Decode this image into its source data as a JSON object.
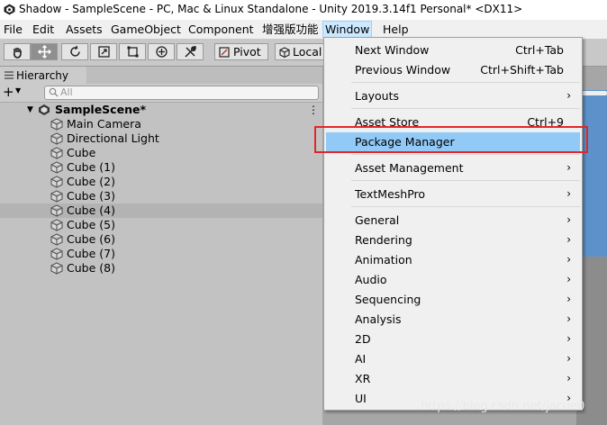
{
  "window": {
    "title": "Shadow - SampleScene - PC, Mac & Linux Standalone - Unity 2019.3.14f1 Personal* <DX11>"
  },
  "menubar": {
    "items": [
      "File",
      "Edit",
      "Assets",
      "GameObject",
      "Component",
      "增强版功能",
      "Window",
      "Help"
    ],
    "active": "Window"
  },
  "toolbar": {
    "pivot_label": "Pivot",
    "local_label": "Local"
  },
  "hierarchy": {
    "tab_label": "Hierarchy",
    "add_label": "+",
    "search_placeholder": "All",
    "scene_name": "SampleScene*",
    "kebab": "⋮",
    "objects": [
      "Main Camera",
      "Directional Light",
      "Cube",
      "Cube (1)",
      "Cube (2)",
      "Cube (3)",
      "Cube (4)",
      "Cube (5)",
      "Cube (6)",
      "Cube (7)",
      "Cube (8)"
    ],
    "selected": "Cube (4)"
  },
  "window_menu": {
    "items": [
      {
        "label": "Next Window",
        "shortcut": "Ctrl+Tab"
      },
      {
        "label": "Previous Window",
        "shortcut": "Ctrl+Shift+Tab"
      },
      {
        "label": "Layouts",
        "submenu": true
      },
      {
        "label": "Asset Store",
        "shortcut": "Ctrl+9"
      },
      {
        "label": "Package Manager",
        "highlighted": true
      },
      {
        "label": "Asset Management",
        "submenu": true
      },
      {
        "label": "TextMeshPro",
        "submenu": true
      },
      {
        "label": "General",
        "submenu": true
      },
      {
        "label": "Rendering",
        "submenu": true
      },
      {
        "label": "Animation",
        "submenu": true
      },
      {
        "label": "Audio",
        "submenu": true
      },
      {
        "label": "Sequencing",
        "submenu": true
      },
      {
        "label": "Analysis",
        "submenu": true
      },
      {
        "label": "2D",
        "submenu": true
      },
      {
        "label": "AI",
        "submenu": true
      },
      {
        "label": "XR",
        "submenu": true
      },
      {
        "label": "UI",
        "submenu": true
      }
    ],
    "submenu_arrow": "›"
  },
  "watermark": "https://blog.csdn.net/jacue0",
  "colors": {
    "highlight": "#91c9f7",
    "annotation_box": "#e0262b",
    "menu_active": "#cce8ff"
  }
}
